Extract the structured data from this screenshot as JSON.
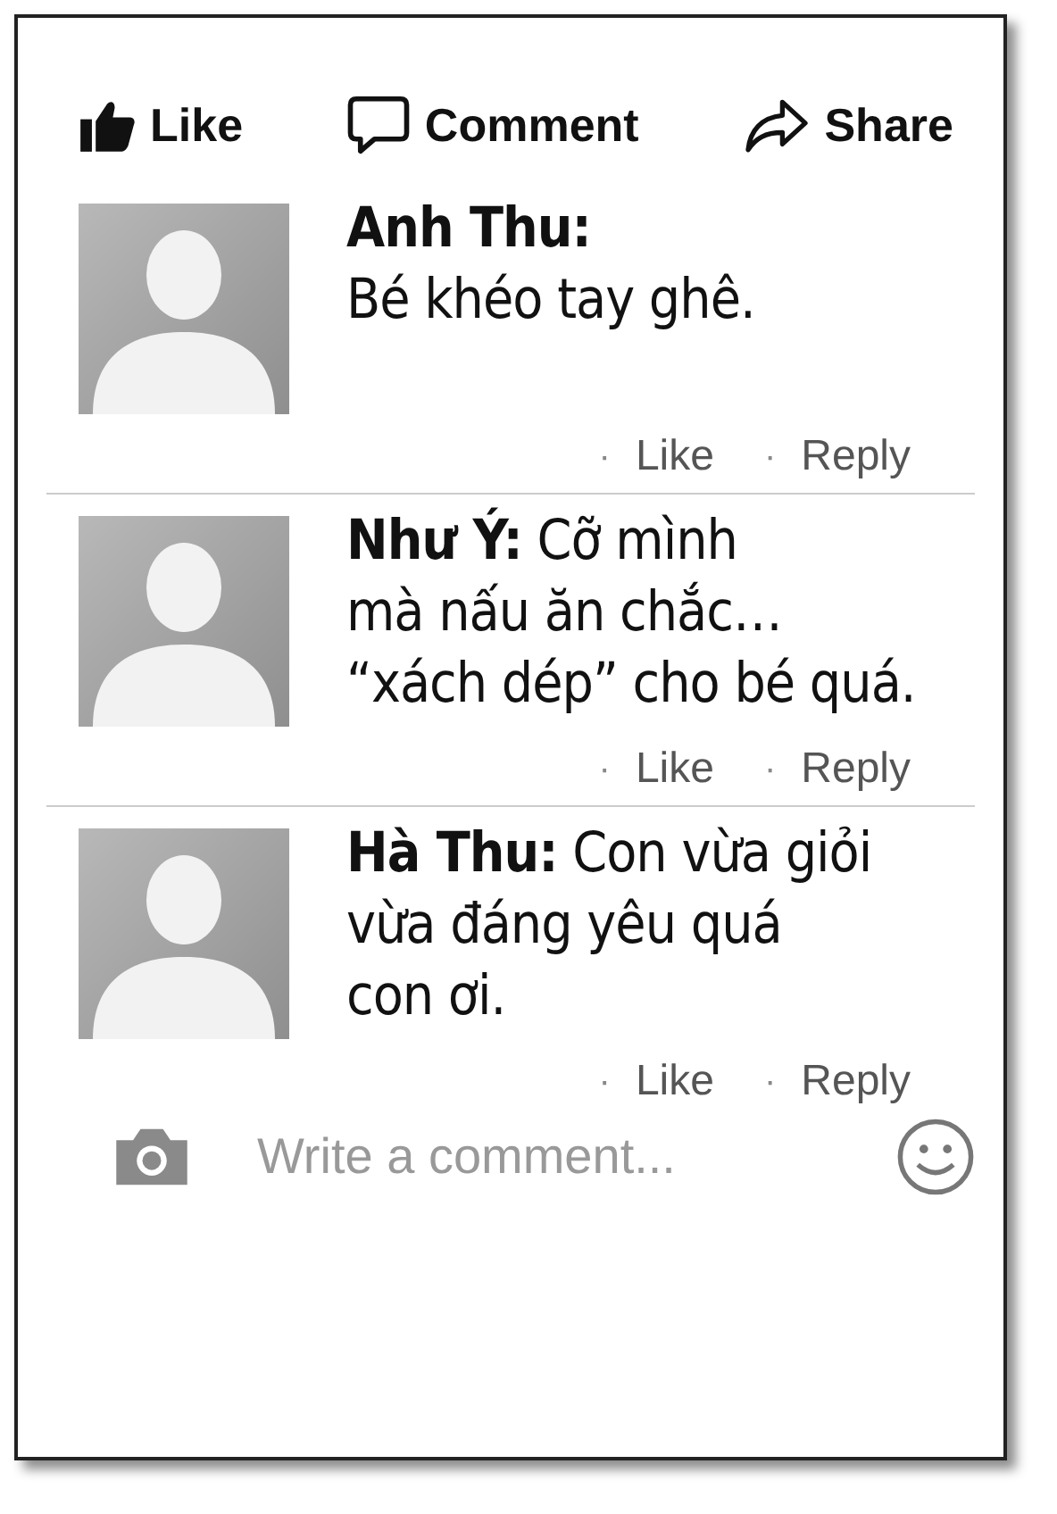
{
  "actions": [
    {
      "kind": "like",
      "label": "Like"
    },
    {
      "kind": "comment",
      "label": "Comment"
    },
    {
      "kind": "share",
      "label": "Share"
    }
  ],
  "comments": [
    {
      "text": "**Anh Thu:**\nBé khéo tay ghê.",
      "links": [
        {
          "dot": "·",
          "label": "Like"
        },
        {
          "dot": "·",
          "label": "Reply"
        }
      ]
    },
    {
      "text": "**Như Ý:** Cỡ mình\nmà nấu ăn chắc…\n“xách dép” cho bé quá.",
      "links": [
        {
          "dot": "·",
          "label": "Like"
        },
        {
          "dot": "·",
          "label": "Reply"
        }
      ]
    },
    {
      "text": "**Hà Thu:** Con vừa giỏi\nvừa đáng yêu quá\ncon ơi.",
      "links": [
        {
          "dot": "·",
          "label": "Like"
        },
        {
          "dot": "·",
          "label": "Reply"
        }
      ]
    }
  ],
  "composer": {
    "placeholder": "Write a comment..."
  }
}
